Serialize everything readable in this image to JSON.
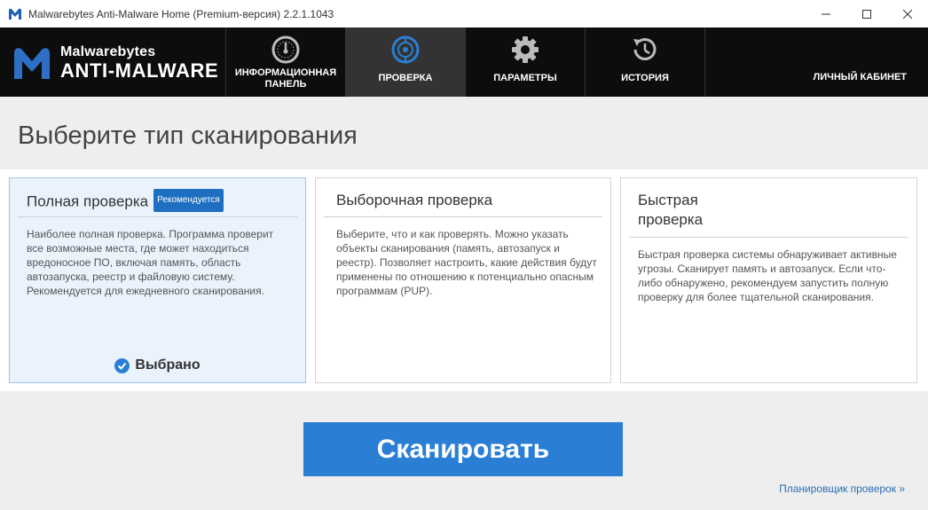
{
  "window": {
    "title": "Malwarebytes Anti-Malware Home (Premium-версия) 2.2.1.1043",
    "controls": [
      "minimize",
      "maximize",
      "close"
    ]
  },
  "logo": {
    "line1": "Malwarebytes",
    "line2": "ANTI-MALWARE"
  },
  "nav": {
    "tabs": [
      {
        "label": "ИНФОРМАЦИОННАЯ ПАНЕЛЬ",
        "icon": "dashboard-icon",
        "active": false
      },
      {
        "label": "ПРОВЕРКА",
        "icon": "scan-icon",
        "active": true
      },
      {
        "label": "ПАРАМЕТРЫ",
        "icon": "gear-icon",
        "active": false
      },
      {
        "label": "ИСТОРИЯ",
        "icon": "history-icon",
        "active": false
      }
    ],
    "account": "ЛИЧНЫЙ КАБИНЕТ"
  },
  "page": {
    "title": "Выберите тип сканирования"
  },
  "cards": [
    {
      "title": "Полная проверка",
      "badge": "Рекомендуется",
      "description": "Наиболее полная проверка. Программа проверит все возможные места, где может находиться вредоносное ПО, включая память, область автозапуска, реестр и файловую систему. Рекомендуется для ежедневного сканирования.",
      "selected": true,
      "selected_label": "Выбрано"
    },
    {
      "title": "Выборочная проверка",
      "description": "Выберите, что и как проверять. Можно указать объекты сканирования (память, автозапуск и реестр). Позволяет настроить, какие действия будут применены по отношению к потенциально опасным программам (PUP).",
      "selected": false
    },
    {
      "title": "Быстрая проверка",
      "description": "Быстрая проверка системы обнаруживает активные угрозы. Сканирует память и автозапуск. Если что-либо обнаружено, рекомендуем запустить полную проверку для более тщательной сканирования.",
      "selected": false
    }
  ],
  "scan_button": "Сканировать",
  "scheduler_link": "Планировщик проверок »",
  "colors": {
    "accent": "#2a7fd4",
    "nav_bg": "#0d0d0d",
    "selected_card_bg": "#eaf3fc"
  }
}
